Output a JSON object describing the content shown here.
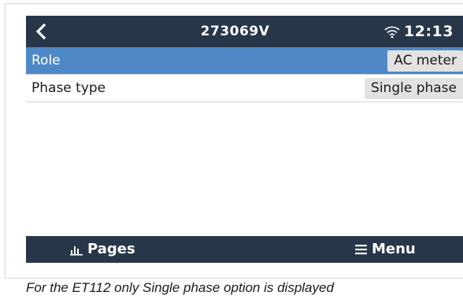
{
  "header": {
    "title": "273069V",
    "time": "12:13"
  },
  "settings": {
    "rows": [
      {
        "label": "Role",
        "value": "AC meter",
        "selected": true
      },
      {
        "label": "Phase type",
        "value": "Single phase",
        "selected": false
      }
    ]
  },
  "footer": {
    "pages_label": "Pages",
    "menu_label": "Menu"
  },
  "caption": "For the ET112 only Single phase option is displayed",
  "icons": {
    "back": "chevron-left-icon",
    "wifi": "wifi-icon",
    "pages": "bar-chart-icon",
    "menu": "hamburger-menu-icon"
  },
  "colors": {
    "topbar": "#28364a",
    "selected_row": "#4f88c6",
    "value_pill": "#e2e2e2"
  }
}
